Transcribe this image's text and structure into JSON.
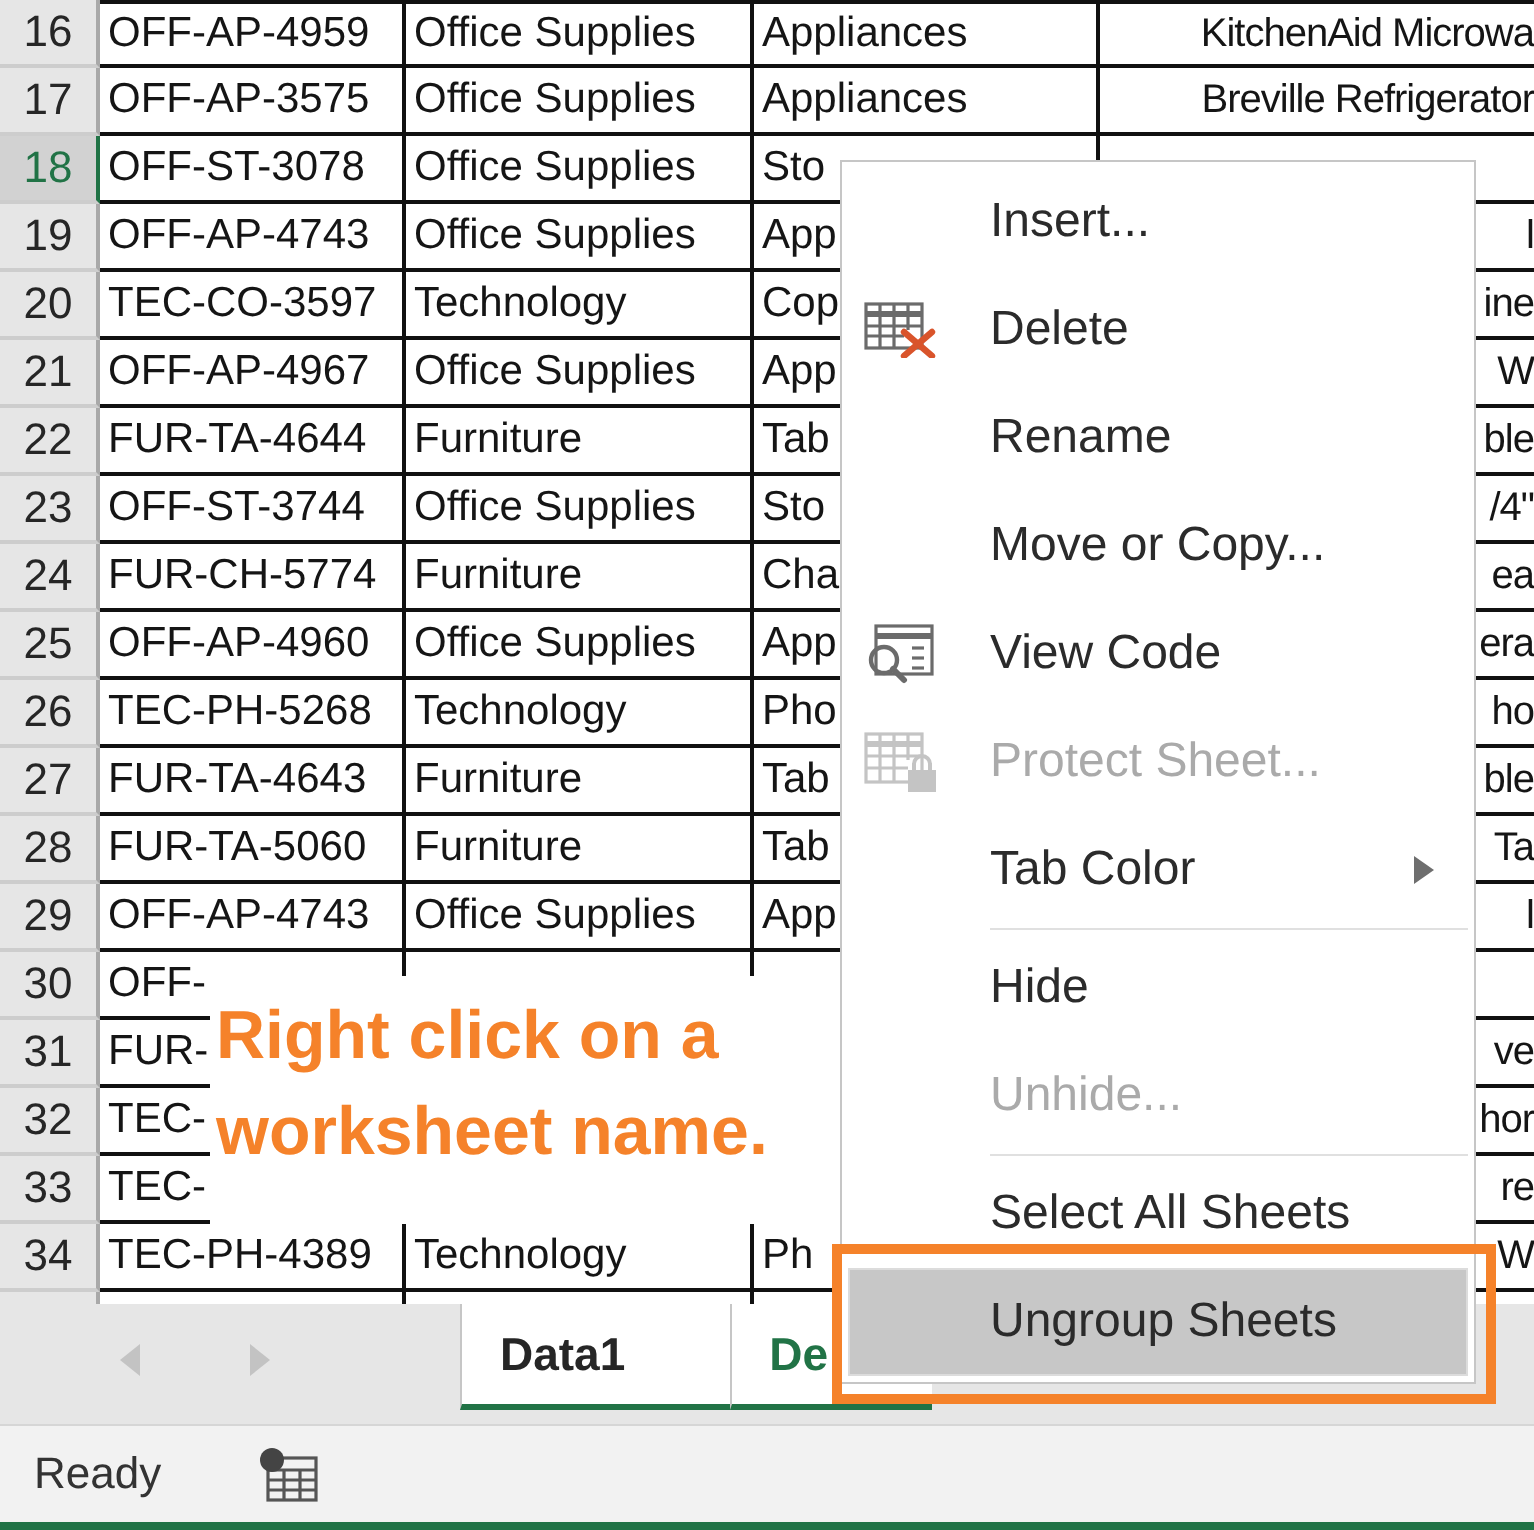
{
  "sheet": {
    "rows": [
      {
        "header": "16",
        "selected": false,
        "column_1": "OFF-AP-4959",
        "column_2": "Office Supplies",
        "column_3": "Appliances",
        "column_4": "KitchenAid Microwa"
      },
      {
        "header": "17",
        "selected": false,
        "column_1": "OFF-AP-3575",
        "column_2": "Office Supplies",
        "column_3": "Appliances",
        "column_4": "Breville Refrigerator"
      },
      {
        "header": "18",
        "selected": true,
        "column_1": "OFF-ST-3078",
        "column_2": "Office Supplies",
        "column_3": "Sto"
      },
      {
        "header": "19",
        "selected": false,
        "column_1": "OFF-AP-4743",
        "column_2": "Office Supplies",
        "column_3": "App",
        "column_4": "l"
      },
      {
        "header": "20",
        "selected": false,
        "column_1": "TEC-CO-3597",
        "column_2": "Technology",
        "column_3": "Cop",
        "column_4": "ine"
      },
      {
        "header": "21",
        "selected": false,
        "column_1": "OFF-AP-4967",
        "column_2": "Office Supplies",
        "column_3": "App",
        "column_4": "W"
      },
      {
        "header": "22",
        "selected": false,
        "column_1": "FUR-TA-4644",
        "column_2": "Furniture",
        "column_3": "Tab",
        "column_4": "ble"
      },
      {
        "header": "23",
        "selected": false,
        "column_1": "OFF-ST-3744",
        "column_2": "Office Supplies",
        "column_3": "Sto",
        "column_4": "/4\""
      },
      {
        "header": "24",
        "selected": false,
        "column_1": "FUR-CH-5774",
        "column_2": "Furniture",
        "column_3": "Cha",
        "column_4": "ea"
      },
      {
        "header": "25",
        "selected": false,
        "column_1": "OFF-AP-4960",
        "column_2": "Office Supplies",
        "column_3": "App",
        "column_4": "era"
      },
      {
        "header": "26",
        "selected": false,
        "column_1": "TEC-PH-5268",
        "column_2": "Technology",
        "column_3": "Pho",
        "column_4": "ho"
      },
      {
        "header": "27",
        "selected": false,
        "column_1": "FUR-TA-4643",
        "column_2": "Furniture",
        "column_3": "Tab",
        "column_4": "ble"
      },
      {
        "header": "28",
        "selected": false,
        "column_1": "FUR-TA-5060",
        "column_2": "Furniture",
        "column_3": "Tab",
        "column_4": "Ta"
      },
      {
        "header": "29",
        "selected": false,
        "column_1": "OFF-AP-4743",
        "column_2": "Office Supplies",
        "column_3": "App",
        "column_4": "l"
      },
      {
        "header": "30",
        "selected": false,
        "column_1": "OFF-"
      },
      {
        "header": "31",
        "selected": false,
        "column_1": "FUR-",
        "column_4": "ve"
      },
      {
        "header": "32",
        "selected": false,
        "column_1": "TEC-",
        "column_4": "hor"
      },
      {
        "header": "33",
        "selected": false,
        "column_1": "TEC-",
        "column_4": "re"
      },
      {
        "header": "34",
        "selected": false,
        "column_1": "TEC-PH-4389",
        "column_2": "Technology",
        "column_3": "Ph",
        "column_4": "W"
      }
    ]
  },
  "callout": {
    "text": "Right click on a worksheet name."
  },
  "context_menu": {
    "items": [
      {
        "kind": "command",
        "label": "Insert...",
        "disabled": false,
        "selected": false,
        "outlined": false
      },
      {
        "kind": "command",
        "label": "Delete",
        "disabled": false,
        "selected": false,
        "outlined": false
      },
      {
        "kind": "command",
        "label": "Rename",
        "disabled": false,
        "selected": false,
        "outlined": false
      },
      {
        "kind": "command",
        "label": "Move or Copy...",
        "disabled": false,
        "selected": false,
        "outlined": false
      },
      {
        "kind": "command",
        "label": "View Code",
        "disabled": false,
        "selected": false,
        "outlined": false
      },
      {
        "kind": "command",
        "label": "Protect Sheet...",
        "disabled": true,
        "selected": false,
        "outlined": false
      },
      {
        "kind": "submenu",
        "label": "Tab Color",
        "disabled": false,
        "selected": false,
        "outlined": false
      },
      {
        "kind": "separator"
      },
      {
        "kind": "command",
        "label": "Hide",
        "disabled": false,
        "selected": false,
        "outlined": false
      },
      {
        "kind": "command",
        "label": "Unhide...",
        "disabled": true,
        "selected": false,
        "outlined": false
      },
      {
        "kind": "separator"
      },
      {
        "kind": "command",
        "label": "Select All Sheets",
        "disabled": false,
        "selected": false,
        "outlined": false
      },
      {
        "kind": "command",
        "label": "Ungroup Sheets",
        "disabled": false,
        "selected": true,
        "outlined": true
      }
    ]
  },
  "sheet_tabs": [
    {
      "label": "Data1",
      "selected": true,
      "active": false
    },
    {
      "label": "De",
      "selected": true,
      "active": true
    }
  ],
  "status_bar": {
    "text": "Ready"
  }
}
